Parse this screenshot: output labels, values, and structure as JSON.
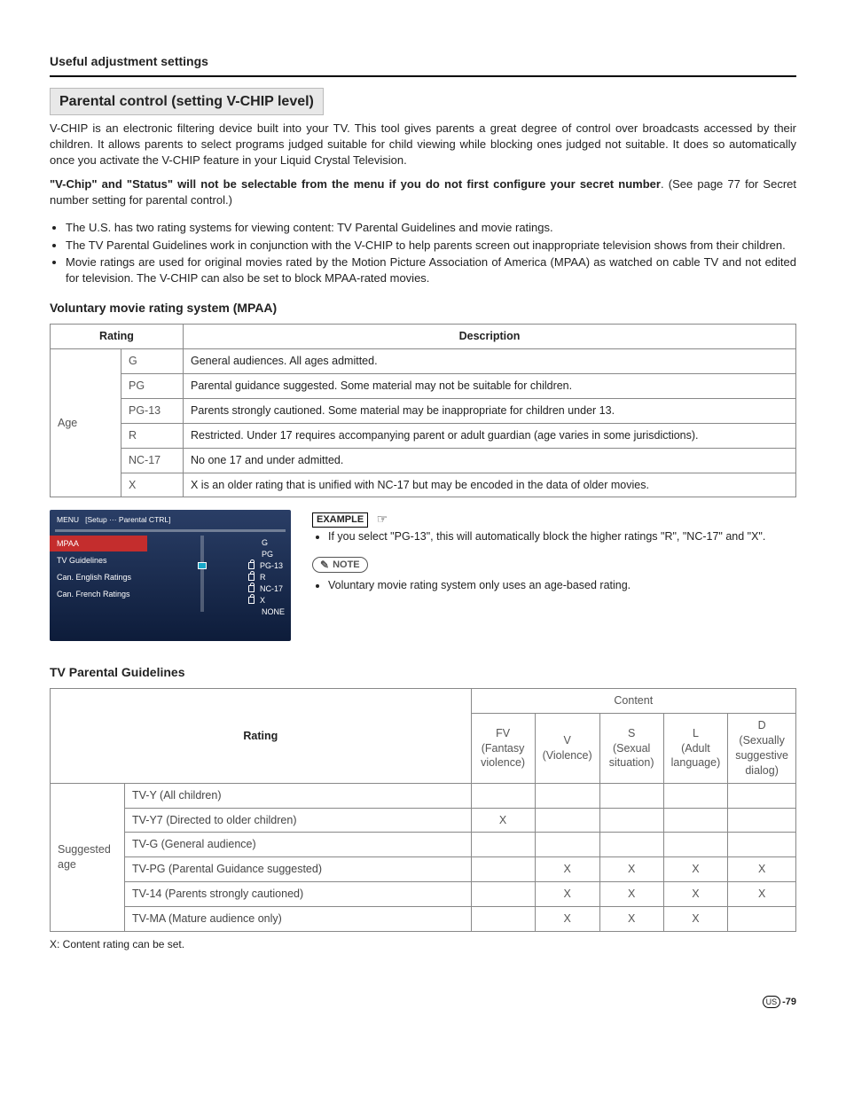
{
  "header": "Useful adjustment settings",
  "section_title": "Parental control (setting V-CHIP level)",
  "intro": "V-CHIP is an electronic filtering device built into your TV. This tool gives parents a great degree of control over broadcasts accessed by their children. It allows parents to select programs judged suitable for child viewing while blocking ones judged not suitable. It does so automatically once you activate the V-CHIP feature in your Liquid Crystal Television.",
  "warn_bold": "\"V-Chip\" and \"Status\" will not be selectable from the menu if you do not first configure your secret number",
  "warn_rest": ". (See page 77 for Secret number setting for parental control.)",
  "bullets": [
    "The U.S. has two rating systems for viewing content: TV Parental Guidelines and movie ratings.",
    "The TV Parental Guidelines work in conjunction with the V-CHIP to help parents screen out inappropriate television shows from their children.",
    "Movie ratings are used for original movies rated by the Motion Picture Association of America (MPAA) as watched on cable TV and not edited for television. The V-CHIP can also be set to block MPAA-rated movies."
  ],
  "mpaa_heading": "Voluntary movie rating system (MPAA)",
  "mpaa_th_rating": "Rating",
  "mpaa_th_desc": "Description",
  "mpaa_age": "Age",
  "mpaa_rows": [
    {
      "r": "G",
      "d": "General audiences. All ages admitted."
    },
    {
      "r": "PG",
      "d": "Parental guidance suggested. Some material may not be suitable for children."
    },
    {
      "r": "PG-13",
      "d": "Parents strongly cautioned. Some material may be inappropriate for children under 13."
    },
    {
      "r": "R",
      "d": "Restricted. Under 17 requires accompanying parent or adult guardian (age varies in some jurisdictions)."
    },
    {
      "r": "NC-17",
      "d": "No one 17 and under admitted."
    },
    {
      "r": "X",
      "d": "X is an older rating that is unified with NC-17 but may be encoded in the data of older movies."
    }
  ],
  "osd": {
    "breadcrumb_menu": "MENU",
    "breadcrumb_path": "[Setup ··· Parental CTRL]",
    "left": [
      "MPAA",
      "TV Guidelines",
      "Can. English Ratings",
      "Can. French Ratings"
    ],
    "right": [
      "G",
      "PG",
      "PG-13",
      "R",
      "NC-17",
      "X",
      "NONE"
    ]
  },
  "example_label": "EXAMPLE",
  "example_text": "If you select \"PG-13\", this will automatically block the higher ratings \"R\", \"NC-17\" and \"X\".",
  "note_label": "NOTE",
  "note_text": "Voluntary movie rating system only uses an age-based rating.",
  "tvpg_heading": "TV Parental Guidelines",
  "tvpg": {
    "rating_hdr": "Rating",
    "content_hdr": "Content",
    "cols": [
      {
        "t": "FV",
        "s": "(Fantasy violence)"
      },
      {
        "t": "V",
        "s": "(Violence)"
      },
      {
        "t": "S",
        "s": "(Sexual situation)"
      },
      {
        "t": "L",
        "s": "(Adult language)"
      },
      {
        "t": "D",
        "s": "(Sexually suggestive dialog)"
      }
    ],
    "age_label": "Suggested age",
    "rows": [
      {
        "label": "TV-Y (All children)",
        "marks": [
          "",
          "",
          "",
          "",
          ""
        ]
      },
      {
        "label": "TV-Y7 (Directed to older children)",
        "marks": [
          "X",
          "",
          "",
          "",
          ""
        ]
      },
      {
        "label": "TV-G (General audience)",
        "marks": [
          "",
          "",
          "",
          "",
          ""
        ]
      },
      {
        "label": "TV-PG (Parental Guidance suggested)",
        "marks": [
          "",
          "X",
          "X",
          "X",
          "X"
        ]
      },
      {
        "label": "TV-14 (Parents strongly cautioned)",
        "marks": [
          "",
          "X",
          "X",
          "X",
          "X"
        ]
      },
      {
        "label": "TV-MA (Mature audience only)",
        "marks": [
          "",
          "X",
          "X",
          "X",
          ""
        ]
      }
    ]
  },
  "tvpg_foot": "X: Content rating can be set.",
  "page_region": "US",
  "page_num": "-79"
}
